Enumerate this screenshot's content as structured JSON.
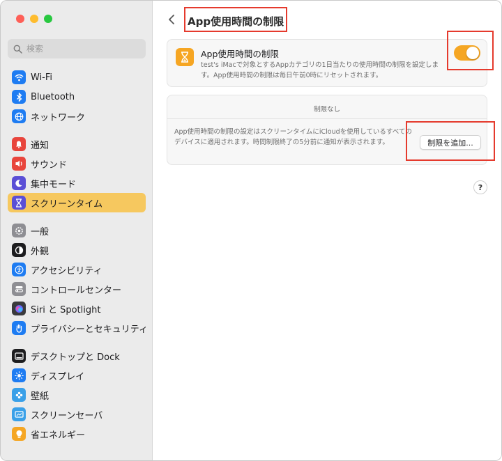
{
  "window": {
    "traffic_lights": [
      "close",
      "minimize",
      "zoom"
    ]
  },
  "sidebar": {
    "search": {
      "placeholder": "検索",
      "icon": "magnifier-icon"
    },
    "groups": [
      [
        {
          "label": "Wi-Fi",
          "icon": "wifi-icon",
          "color": "#1e7cf2"
        },
        {
          "label": "Bluetooth",
          "icon": "bluetooth-icon",
          "color": "#1e7cf2"
        },
        {
          "label": "ネットワーク",
          "icon": "globe-icon",
          "color": "#1e7cf2"
        }
      ],
      [
        {
          "label": "通知",
          "icon": "bell-icon",
          "color": "#e8453c"
        },
        {
          "label": "サウンド",
          "icon": "speaker-icon",
          "color": "#e8453c"
        },
        {
          "label": "集中モード",
          "icon": "moon-icon",
          "color": "#5b4fd6"
        },
        {
          "label": "スクリーンタイム",
          "icon": "hourglass-icon",
          "color": "#5b4fd6",
          "selected": true
        }
      ],
      [
        {
          "label": "一般",
          "icon": "gear-icon",
          "color": "#8e8e93"
        },
        {
          "label": "外観",
          "icon": "appearance-icon",
          "color": "#1d1d1f"
        },
        {
          "label": "アクセシビリティ",
          "icon": "accessibility-icon",
          "color": "#1e7cf2"
        },
        {
          "label": "コントロールセンター",
          "icon": "control-center-icon",
          "color": "#8e8e93"
        },
        {
          "label": "Siri と Spotlight",
          "icon": "siri-icon",
          "color": "#3a3a3c"
        },
        {
          "label": "プライバシーとセキュリティ",
          "icon": "hand-icon",
          "color": "#1e7cf2"
        }
      ],
      [
        {
          "label": "デスクトップと Dock",
          "icon": "dock-icon",
          "color": "#1d1d1f"
        },
        {
          "label": "ディスプレイ",
          "icon": "sun-icon",
          "color": "#1e7cf2"
        },
        {
          "label": "壁紙",
          "icon": "wallpaper-icon",
          "color": "#3aa0e8"
        },
        {
          "label": "スクリーンセーバ",
          "icon": "screensaver-icon",
          "color": "#3aa0e8"
        },
        {
          "label": "省エネルギー",
          "icon": "lightbulb-icon",
          "color": "#f5a623"
        }
      ]
    ]
  },
  "main": {
    "title": "App使用時間の制限",
    "limit_card": {
      "title": "App使用時間の制限",
      "description": "test's iMacで対象とするAppカテゴリの1日当たりの使用時間の制限を設定します。App使用時間の制限は毎日午前0時にリセットされます。",
      "toggle_on": true,
      "icon_color": "#f6a623"
    },
    "limits_list": {
      "empty_text": "制限なし",
      "description": "App使用時間の制限の設定はスクリーンタイムにiCloudを使用しているすべてのデバイスに適用されます。時間制限終了の5分前に通知が表示されます。",
      "add_button": "制限を追加..."
    },
    "help_button": "?"
  },
  "accent_colors": {
    "selected_row": "#f6c85f",
    "toggle": "#f5a623",
    "highlight_box": "#e53a2d"
  }
}
